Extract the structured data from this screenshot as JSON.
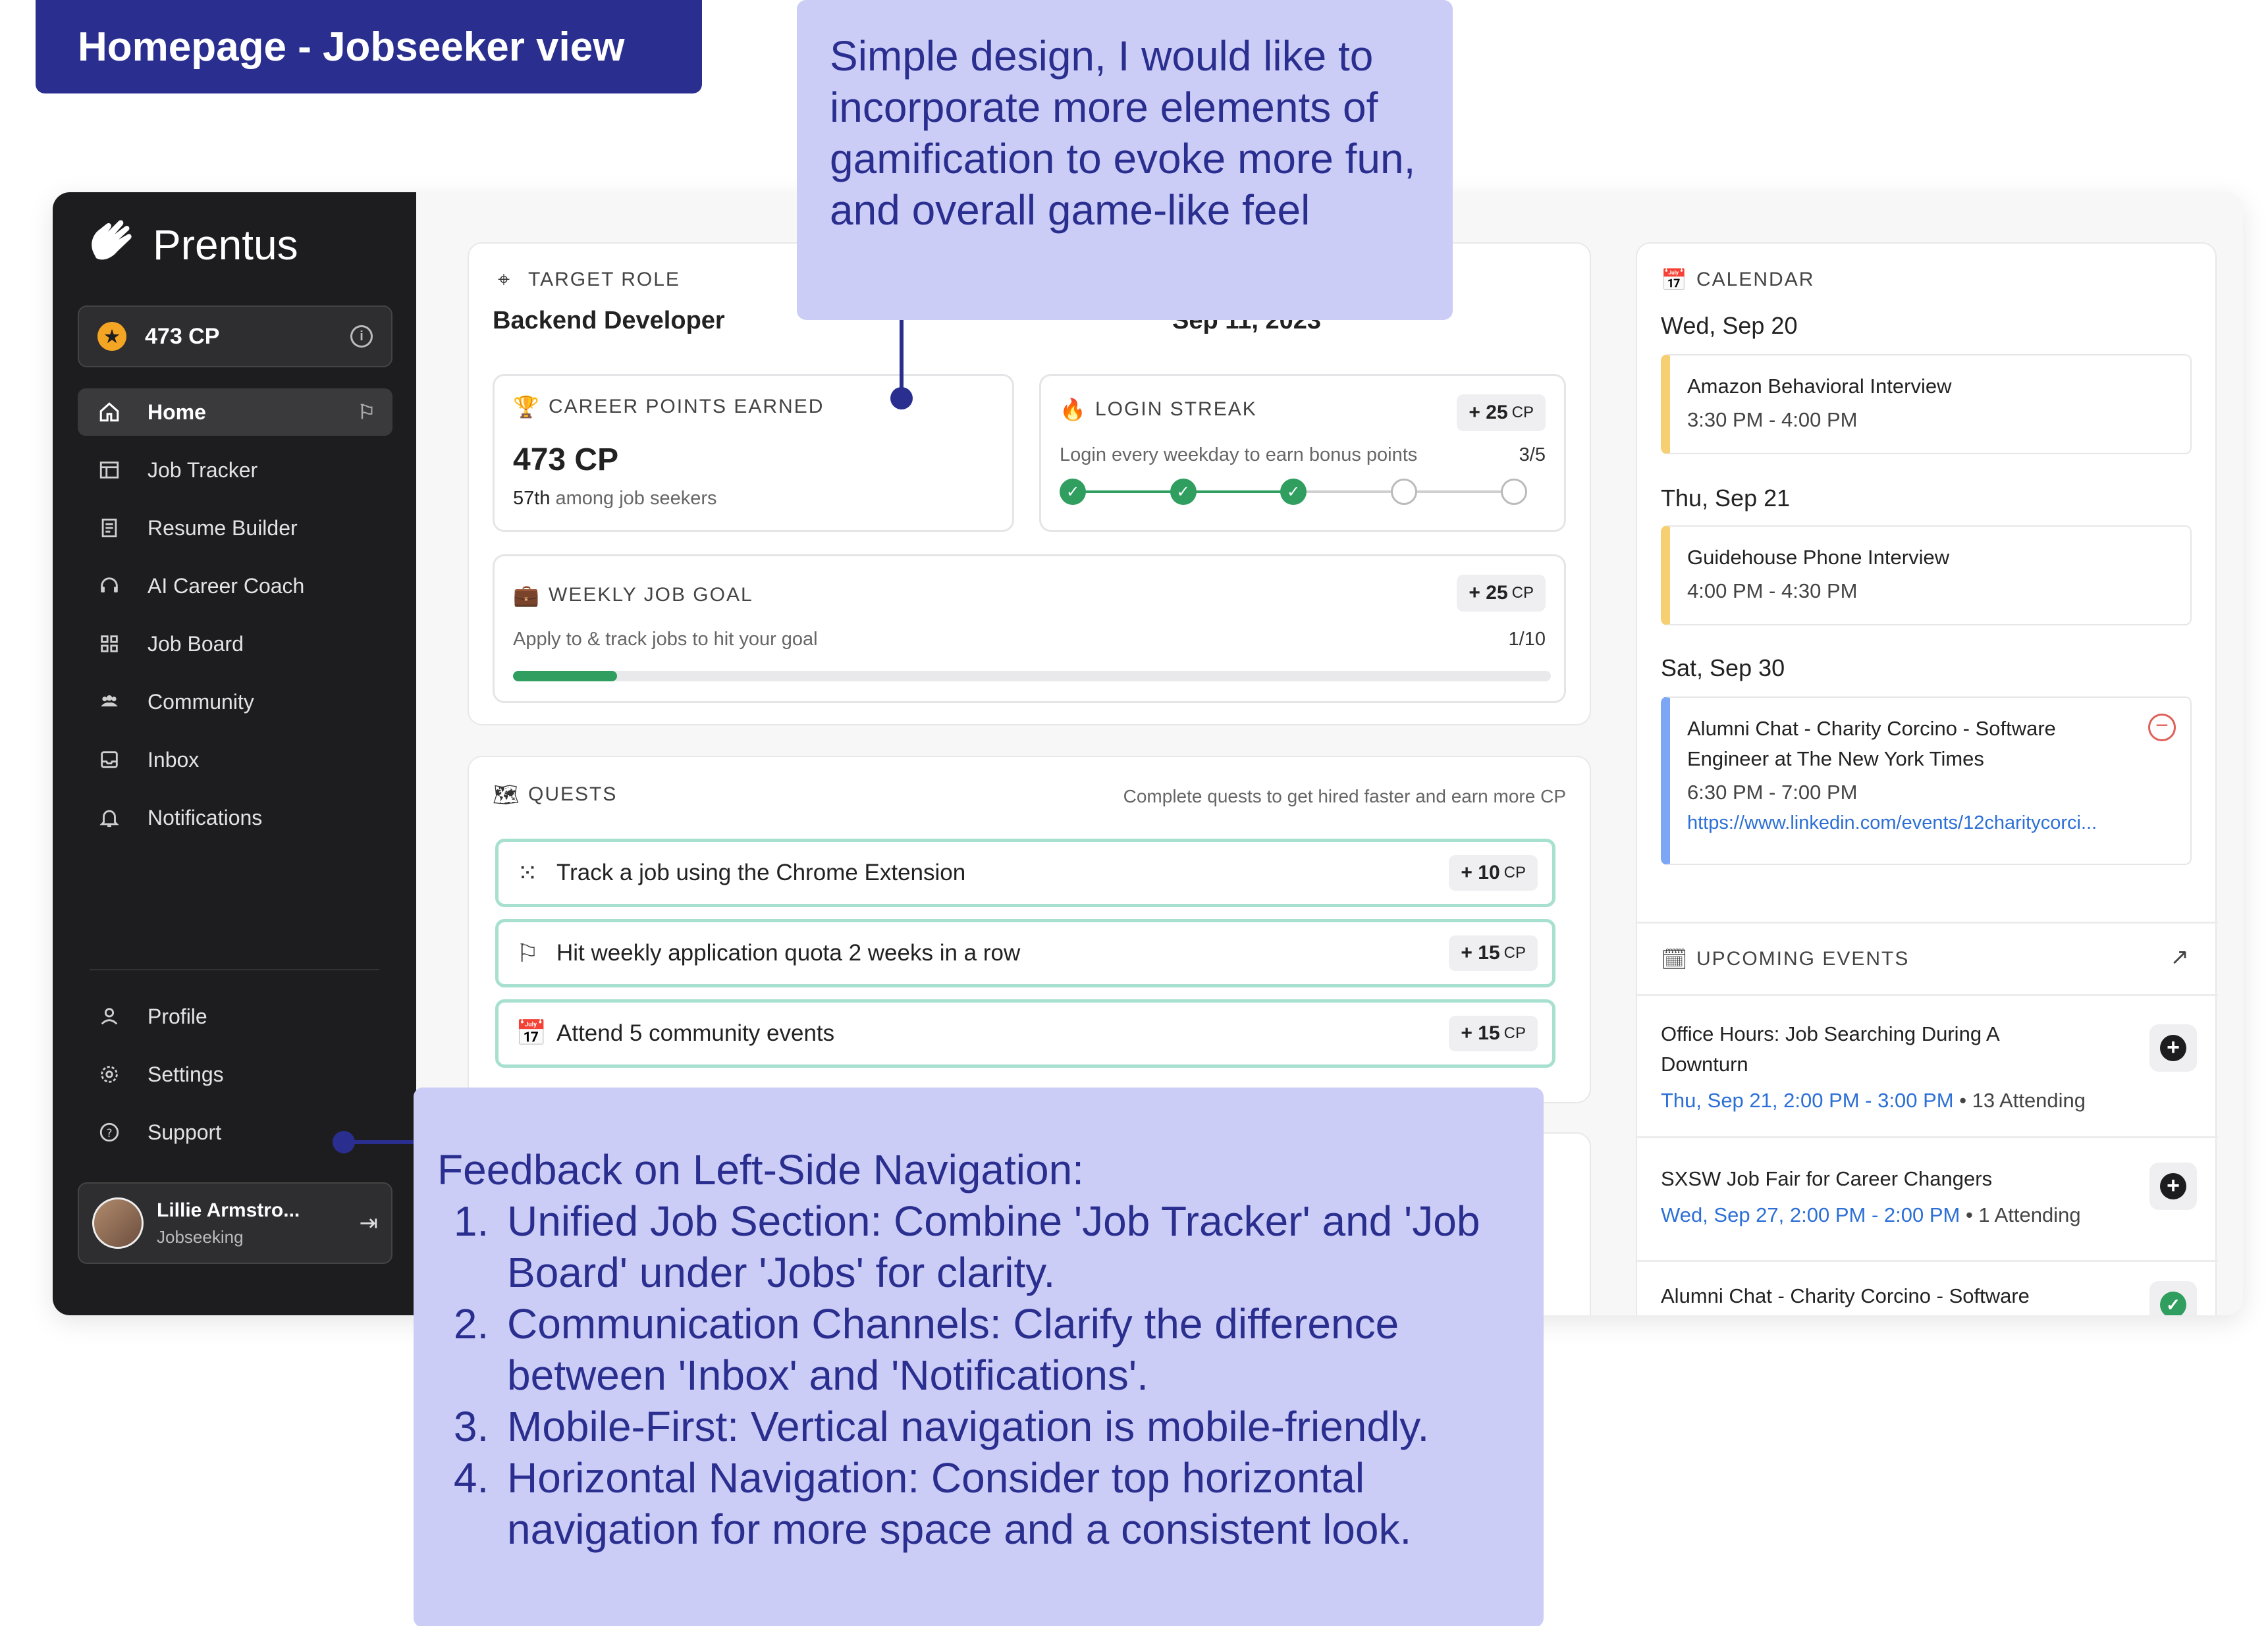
{
  "page_title": "Homepage - Jobseeker view",
  "notes": {
    "top": "Simple design, I would like to incorporate more elements of gamification to evoke more fun, and overall game-like feel",
    "bottom_heading": "Feedback on Left-Side Navigation:",
    "bottom_items": [
      "Unified Job Section: Combine 'Job Tracker' and 'Job Board' under 'Jobs' for clarity.",
      "Communication Channels: Clarify the difference between 'Inbox' and 'Notifications'.",
      "Mobile-First: Vertical navigation is mobile-friendly.",
      "Horizontal Navigation: Consider top horizontal navigation for more space and a consistent look."
    ]
  },
  "sidebar": {
    "brand": "Prentus",
    "cp_total": "473 CP",
    "items": [
      {
        "label": "Home",
        "icon": "home-icon",
        "active": true
      },
      {
        "label": "Job Tracker",
        "icon": "table-icon"
      },
      {
        "label": "Resume Builder",
        "icon": "document-icon"
      },
      {
        "label": "AI Career Coach",
        "icon": "headset-icon"
      },
      {
        "label": "Job Board",
        "icon": "grid-icon"
      },
      {
        "label": "Community",
        "icon": "people-icon"
      },
      {
        "label": "Inbox",
        "icon": "inbox-icon"
      },
      {
        "label": "Notifications",
        "icon": "bell-icon"
      }
    ],
    "bottom_items": [
      {
        "label": "Profile",
        "icon": "person-icon"
      },
      {
        "label": "Settings",
        "icon": "gear-icon"
      },
      {
        "label": "Support",
        "icon": "help-icon"
      }
    ],
    "user": {
      "name": "Lillie Armstro...",
      "status": "Jobseeking"
    }
  },
  "target": {
    "label": "TARGET ROLE",
    "role": "Backend Developer",
    "date": "Sep 11, 2023"
  },
  "career_points": {
    "label": "CAREER POINTS EARNED",
    "value": "473 CP",
    "rank_strong": "57th",
    "rank_rest": " among job seekers"
  },
  "login_streak": {
    "label": "LOGIN STREAK",
    "bonus": "+ 25",
    "bonus_unit": "CP",
    "desc": "Login every weekday to earn bonus points",
    "count": "3/5",
    "completed": 3,
    "total": 5
  },
  "weekly_goal": {
    "label": "WEEKLY JOB GOAL",
    "bonus": "+ 25",
    "bonus_unit": "CP",
    "desc": "Apply to & track jobs to hit your goal",
    "count": "1/10",
    "progress": 0.1
  },
  "quests": {
    "label": "QUESTS",
    "hint": "Complete quests to get hired faster and earn more CP",
    "items": [
      {
        "label": "Track a job using the Chrome Extension",
        "points": "+ 10",
        "unit": "CP",
        "icon": "grid-dots-icon"
      },
      {
        "label": "Hit weekly application quota 2 weeks in a row",
        "points": "+ 15",
        "unit": "CP",
        "icon": "flag-icon"
      },
      {
        "label": "Attend 5 community events",
        "points": "+ 15",
        "unit": "CP",
        "icon": "calendar-icon"
      }
    ]
  },
  "calendar": {
    "label": "CALENDAR",
    "days": [
      {
        "day": "Wed, Sep 20",
        "title": "Amazon Behavioral Interview",
        "time": "3:30 PM - 4:00 PM"
      },
      {
        "day": "Thu, Sep 21",
        "title": "Guidehouse Phone Interview",
        "time": "4:00 PM - 4:30 PM"
      },
      {
        "day": "Sat, Sep 30",
        "title": "Alumni Chat - Charity Corcino - Software Engineer at The New York Times",
        "time": "6:30 PM - 7:00 PM",
        "link": "https://www.linkedin.com/events/12charitycorci..."
      }
    ]
  },
  "upcoming": {
    "label": "UPCOMING EVENTS",
    "items": [
      {
        "title": "Office Hours: Job Searching During A Downturn",
        "date": "Thu, Sep 21, 2:00 PM - 3:00 PM",
        "attending": " • 13 Attending"
      },
      {
        "title": "SXSW Job Fair for Career Changers",
        "date": "Wed, Sep 27, 2:00 PM - 2:00 PM",
        "attending": " • 1 Attending"
      },
      {
        "title": "Alumni Chat - Charity Corcino - Software",
        "date": "",
        "attending": ""
      }
    ]
  },
  "colors": {
    "accent": "#2a2f8f",
    "note_bg": "#cccdf6",
    "success": "#2f9e5f",
    "sidebar_bg": "#1d1d1f"
  }
}
